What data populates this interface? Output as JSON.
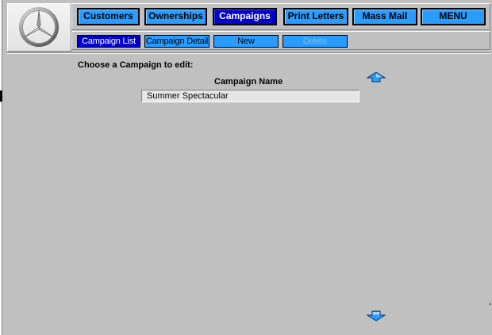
{
  "nav": {
    "tabs": [
      {
        "label": "Customers",
        "active": false
      },
      {
        "label": "Ownerships",
        "active": false
      },
      {
        "label": "Campaigns",
        "active": true
      },
      {
        "label": "Print Letters",
        "active": false
      },
      {
        "label": "Mass Mail",
        "active": false
      },
      {
        "label": "MENU",
        "active": false
      }
    ]
  },
  "subnav": {
    "items": [
      {
        "label": "Campaign List",
        "state": "active"
      },
      {
        "label": "Campaign Detail",
        "state": "normal"
      },
      {
        "label": "New",
        "state": "normal"
      },
      {
        "label": "Delete",
        "state": "disabled"
      }
    ]
  },
  "main": {
    "prompt": "Choose a Campaign to edit:",
    "column_header": "Campaign Name",
    "rows": [
      "Summer Spectacular"
    ]
  },
  "icons": {
    "logo": "mercedes-star-icon",
    "scroll_up": "arrow-up-icon",
    "scroll_down": "arrow-down-icon"
  },
  "colors": {
    "tab": "#2a9cff",
    "tab_active": "#0000cc",
    "background": "#c0c0c0"
  }
}
